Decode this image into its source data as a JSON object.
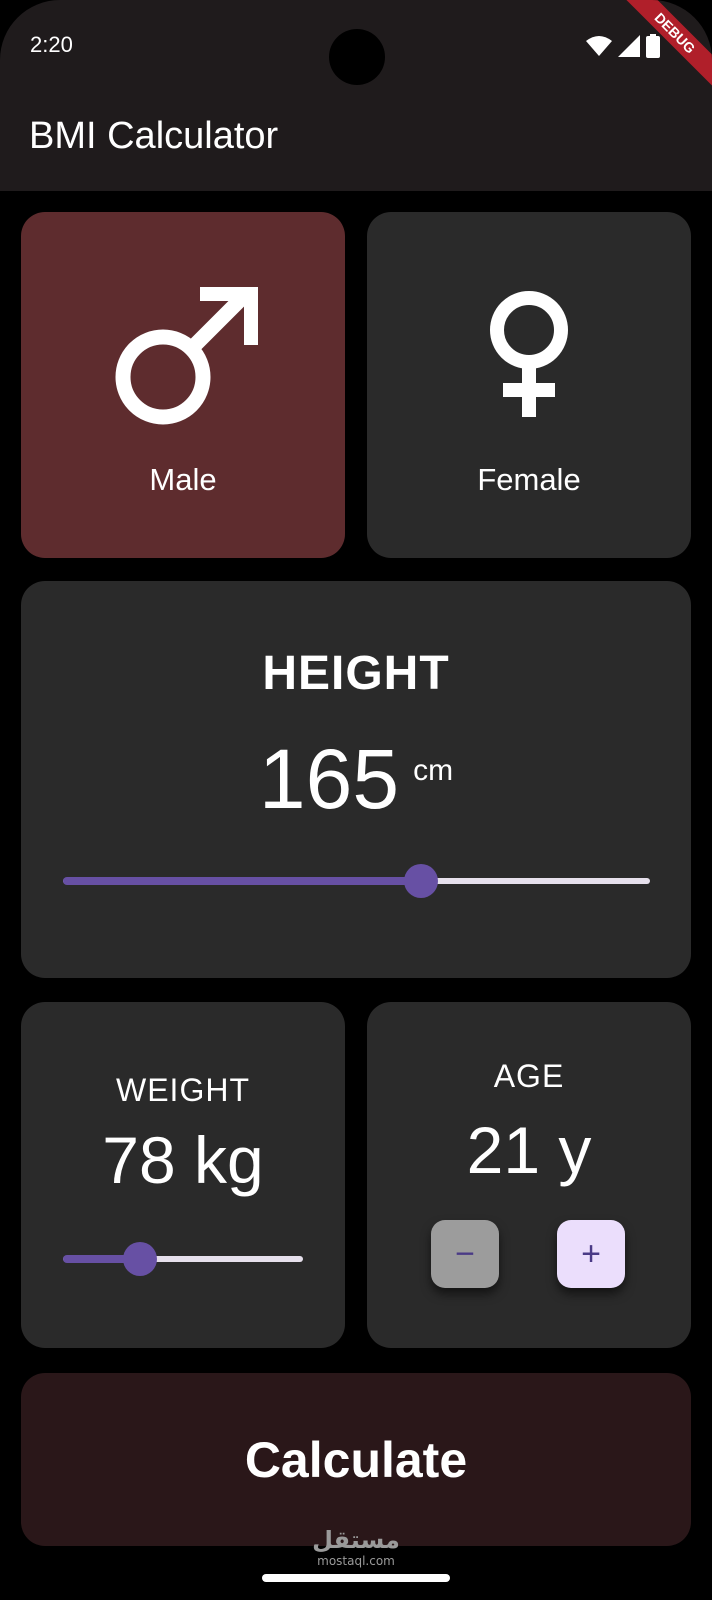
{
  "status_bar": {
    "time": "2:20",
    "debug_label": "DEBUG",
    "icons": [
      "wifi-icon",
      "signal-icon",
      "battery-icon"
    ]
  },
  "app_bar": {
    "title": "BMI Calculator"
  },
  "gender": {
    "male": {
      "label": "Male",
      "icon": "male-symbol-icon",
      "selected": true
    },
    "female": {
      "label": "Female",
      "icon": "female-symbol-icon",
      "selected": false
    }
  },
  "height": {
    "title": "HEIGHT",
    "value": "165",
    "unit": "cm",
    "slider_fraction": 0.61
  },
  "weight": {
    "title": "WEIGHT",
    "value_text": "78 kg",
    "slider_fraction": 0.32
  },
  "age": {
    "title": "AGE",
    "value_text": "21 y",
    "minus_label": "−",
    "plus_label": "+"
  },
  "calculate_button": {
    "label": "Calculate"
  },
  "watermark": {
    "arabic": "مستقل",
    "latin": "mostaql.com"
  },
  "colors": {
    "selected_card": "#5e2c2e",
    "card": "#2a2a2a",
    "accent": "#6750a4",
    "calculate_bg": "#2a1719"
  }
}
